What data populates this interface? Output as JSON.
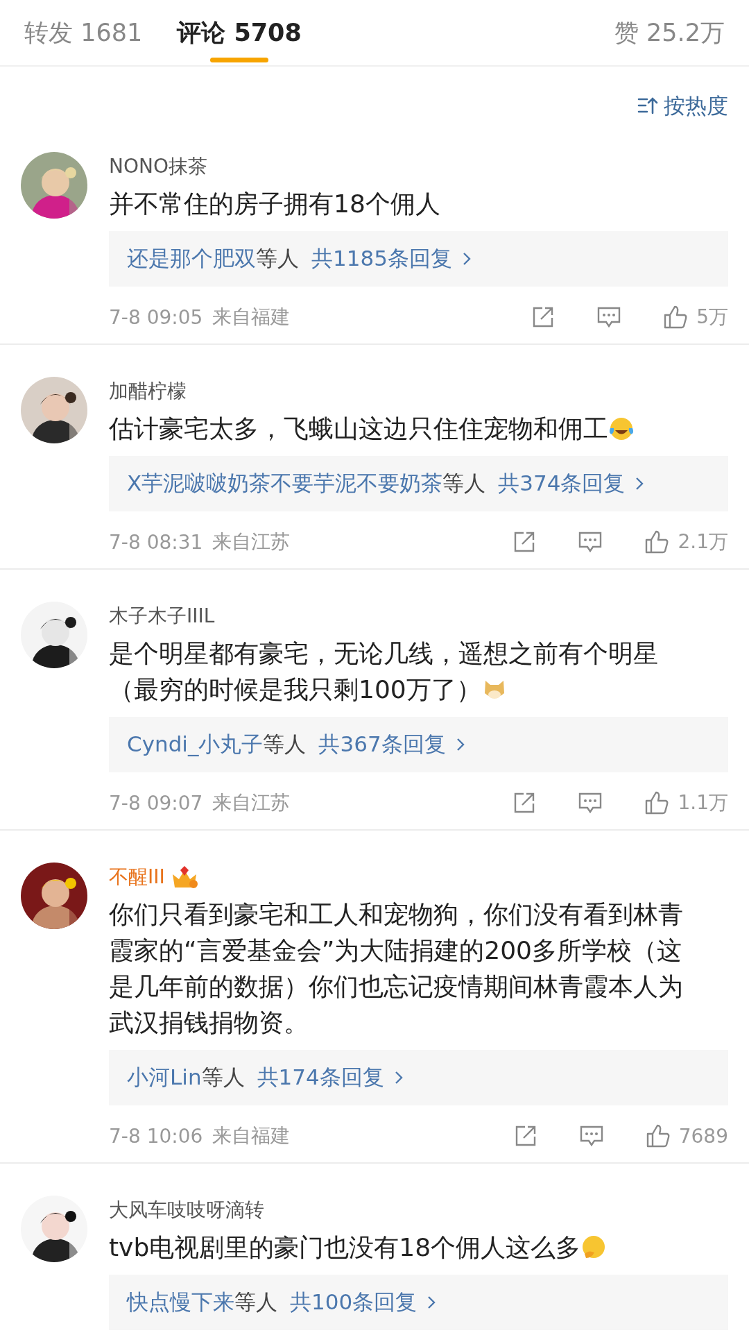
{
  "tabs": [
    {
      "label": "转发 1681",
      "selected": false
    },
    {
      "label": "评论 5708",
      "selected": true
    }
  ],
  "likes_total": "赞 25.2万",
  "sort": {
    "label": "按热度"
  },
  "comments": [
    {
      "avatar": {
        "kind": "picture"
      },
      "name": "NONO抹茶",
      "vip": false,
      "lines": [
        "并不常住的房子拥有18个佣人"
      ],
      "reply": {
        "names": "还是那个肥双",
        "suffix": "等人",
        "count": "共1185条回复"
      },
      "time": "7-8 09:05",
      "location": "来自福建",
      "likes": "5万"
    },
    {
      "avatar": {
        "kind": "picture"
      },
      "name": "加醋柠檬",
      "vip": false,
      "lines": [
        "估计豪宅太多，飞蛾山这边只住住宠物和佣工"
      ],
      "emoji": {
        "kind": "laugh-cry"
      },
      "reply": {
        "names": "X芋泥啵啵奶茶不要芋泥不要奶茶",
        "suffix": "等人",
        "count": "共374条回复"
      },
      "time": "7-8 08:31",
      "location": "来自江苏",
      "likes": "2.1万"
    },
    {
      "avatar": {
        "kind": "picture"
      },
      "name": "木子木子IIIL",
      "vip": false,
      "lines": [
        "是个明星都有豪宅，无论几线，遥想之前有个明星",
        "（最穷的时候是我只剩100万了）"
      ],
      "emoji": {
        "kind": "dog"
      },
      "reply": {
        "names": "Cyndi_小丸子",
        "suffix": "等人",
        "count": "共367条回复"
      },
      "time": "7-8 09:07",
      "location": "来自江苏",
      "likes": "1.1万"
    },
    {
      "avatar": {
        "kind": "picture"
      },
      "name": "不醒III",
      "vip": true,
      "badge": {
        "kind": "crown"
      },
      "lines": [
        "你们只看到豪宅和工人和宠物狗，你们没有看到林青",
        "霞家的“言爱基金会”为大陆捐建的200多所学校（这",
        "是几年前的数据）你们也忘记疫情期间林青霞本人为",
        "武汉捐钱捐物资。"
      ],
      "reply": {
        "names": "小河Lin",
        "suffix": "等人",
        "count": "共174条回复"
      },
      "time": "7-8 10:06",
      "location": "来自福建",
      "likes": "7689"
    },
    {
      "avatar": {
        "kind": "picture"
      },
      "name": "大风车吱吱呀滴转",
      "vip": false,
      "lines": [
        "tvb电视剧里的豪门也没有18个佣人这么多"
      ],
      "emoji": {
        "kind": "thinking"
      },
      "reply": {
        "names": "快点慢下来",
        "suffix": "等人",
        "count": "共100条回复"
      }
    }
  ]
}
